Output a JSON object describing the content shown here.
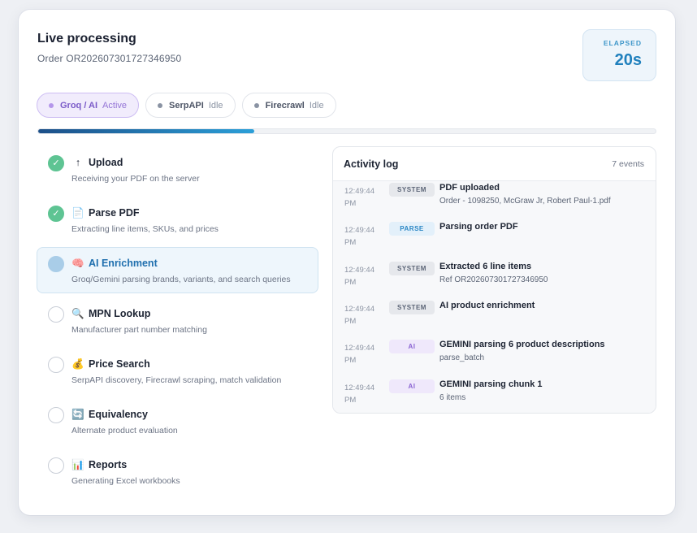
{
  "header": {
    "title": "Live processing",
    "subtitle": "Order OR202607301727346950",
    "elapsed_label": "ELAPSED",
    "elapsed_value": "20s"
  },
  "services": [
    {
      "name": "Groq / AI",
      "state": "Active",
      "active": true
    },
    {
      "name": "SerpAPI",
      "state": "Idle",
      "active": false
    },
    {
      "name": "Firecrawl",
      "state": "Idle",
      "active": false
    }
  ],
  "progress": {
    "fraction": 0.35
  },
  "steps": [
    {
      "icon": "↑",
      "icon_name": "upload-arrow-icon",
      "name": "Upload",
      "desc": "Receiving your PDF on the server",
      "status": "done"
    },
    {
      "icon": "📄",
      "icon_name": "document-icon",
      "name": "Parse PDF",
      "desc": "Extracting line items, SKUs, and prices",
      "status": "done"
    },
    {
      "icon": "🧠",
      "icon_name": "brain-icon",
      "name": "AI Enrichment",
      "desc": "Groq/Gemini parsing brands, variants, and search queries",
      "status": "current"
    },
    {
      "icon": "🔍",
      "icon_name": "magnifier-icon",
      "name": "MPN Lookup",
      "desc": "Manufacturer part number matching",
      "status": "pending"
    },
    {
      "icon": "💰",
      "icon_name": "money-bag-icon",
      "name": "Price Search",
      "desc": "SerpAPI discovery, Firecrawl scraping, match validation",
      "status": "pending"
    },
    {
      "icon": "🔄",
      "icon_name": "refresh-icon",
      "name": "Equivalency",
      "desc": "Alternate product evaluation",
      "status": "pending"
    },
    {
      "icon": "📊",
      "icon_name": "bar-chart-icon",
      "name": "Reports",
      "desc": "Generating Excel workbooks",
      "status": "pending"
    }
  ],
  "log": {
    "title": "Activity log",
    "count": "7 events",
    "entries": [
      {
        "time": "12:49:44 PM",
        "tag": "SYSTEM",
        "kind": "system",
        "title": "PDF uploaded",
        "detail": "Order - 1098250, McGraw Jr, Robert Paul-1.pdf"
      },
      {
        "time": "12:49:44 PM",
        "tag": "PARSE",
        "kind": "parse",
        "title": "Parsing order PDF",
        "detail": ""
      },
      {
        "time": "12:49:44 PM",
        "tag": "SYSTEM",
        "kind": "system",
        "title": "Extracted 6 line items",
        "detail": "Ref OR202607301727346950"
      },
      {
        "time": "12:49:44 PM",
        "tag": "SYSTEM",
        "kind": "system",
        "title": "AI product enrichment",
        "detail": ""
      },
      {
        "time": "12:49:44 PM",
        "tag": "AI",
        "kind": "ai",
        "title": "GEMINI parsing 6 product descriptions",
        "detail": "parse_batch"
      },
      {
        "time": "12:49:44 PM",
        "tag": "AI",
        "kind": "ai",
        "title": "GEMINI parsing chunk 1",
        "detail": "6 items"
      }
    ]
  }
}
